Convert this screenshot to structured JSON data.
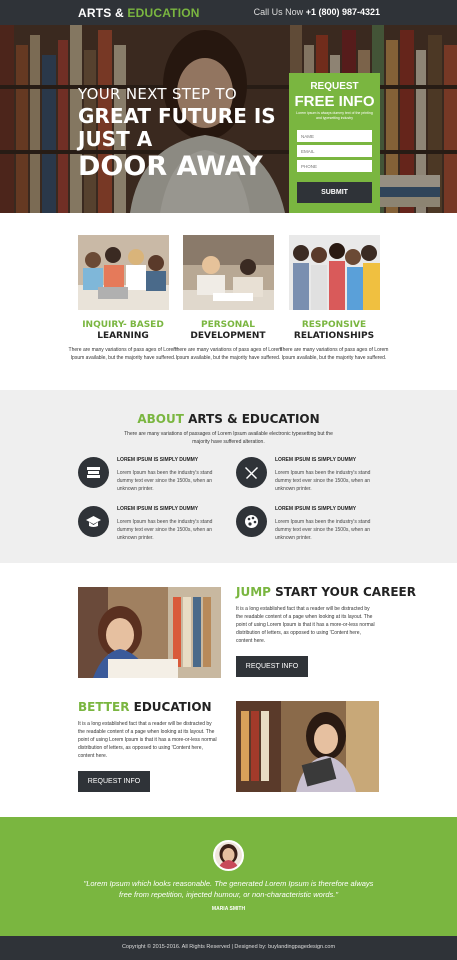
{
  "header": {
    "brand_part1": "ARTS & ",
    "brand_part2": "EDUCATION",
    "call_label": "Call Us Now",
    "phone": "+1 (800) 987-4321"
  },
  "hero": {
    "subtitle": "YOUR NEXT STEP TO",
    "title_line1": "GREAT FUTURE IS JUST A",
    "title_line2": "DOOR AWAY",
    "form": {
      "heading1": "REQUEST",
      "heading2": "FREE INFO",
      "note": "Lorem ipsum is always dummy text of the printing and typesetting industry",
      "name_placeholder": "NAME",
      "email_placeholder": "EMAIL",
      "phone_placeholder": "PHONE",
      "submit_label": "SUBMIT"
    }
  },
  "features": [
    {
      "title_green": "INQUIRY- BASED",
      "title_dark": "LEARNING",
      "text": "There are many variations of pass ages of Lorem Ipsum available, but the majority have suffered."
    },
    {
      "title_green": "PERSONAL",
      "title_dark": "DEVELOPMENT",
      "text": "There are many variations of pass ages of Lorem Ipsum available, but the majority have suffered."
    },
    {
      "title_green": "RESPONSIVE",
      "title_dark": "RELATIONSHIPS",
      "text": "There are many variations of pass ages of Lorem Ipsum available, but the majority have suffered."
    }
  ],
  "about": {
    "title_green": "ABOUT",
    "title_dark": " ARTS & EDUCATION",
    "description": "There are many variations of passages of Lorem Ipsum available electronic typesetting but the majority have suffered alteration.",
    "items": [
      {
        "heading": "LOREM IPSUM IS SIMPLY DUMMY",
        "text": "Lorem Ipsum has been the industry's stand dummy text ever since the 1500s, when an unknown printer.",
        "icon": "books-icon"
      },
      {
        "heading": "LOREM IPSUM IS SIMPLY DUMMY",
        "text": "Lorem Ipsum has been the industry's stand dummy text ever since the 1500s, when an unknown printer.",
        "icon": "pencil-ruler-icon"
      },
      {
        "heading": "LOREM IPSUM IS SIMPLY DUMMY",
        "text": "Lorem Ipsum has been the industry's stand dummy text ever since the 1500s, when an unknown printer.",
        "icon": "graduation-cap-icon"
      },
      {
        "heading": "LOREM IPSUM IS SIMPLY DUMMY",
        "text": "Lorem Ipsum has been the industry's stand dummy text ever since the 1500s, when an unknown printer.",
        "icon": "palette-icon"
      }
    ]
  },
  "career": {
    "title_green": "JUMP",
    "title_dark": " START YOUR CAREER",
    "text": "It is a long established fact that a reader will be distracted by the readable content of a page when looking at its layout. The point of using Lorem Ipsum is that it has a more-or-less normal distribution of letters, as opposed to using 'Content here, content here.",
    "button": "REQUEST INFO"
  },
  "education": {
    "title_green": "BETTER",
    "title_dark": " EDUCATION",
    "text": "It is a long established fact that a reader will be distracted by the readable content of a page when looking at its layout. The point of using Lorem Ipsum is that it has a more-or-less normal distribution of letters, as opposed to using 'Content here, content here.",
    "button": "REQUEST INFO"
  },
  "testimonial": {
    "quote": "\"Lorem Ipsum which looks reasonable. The generated Lorem Ipsum is therefore always free from repetition, injected humour, or non-characteristic words.\"",
    "name": "MARIA SMITH"
  },
  "footer": {
    "text": "Copyright © 2015-2016. All Rights Reserved  |  Designed by: buylandingpagedesign.com"
  },
  "colors": {
    "accent": "#7ab640",
    "dark": "#2f3338",
    "light_bg": "#efefef"
  }
}
